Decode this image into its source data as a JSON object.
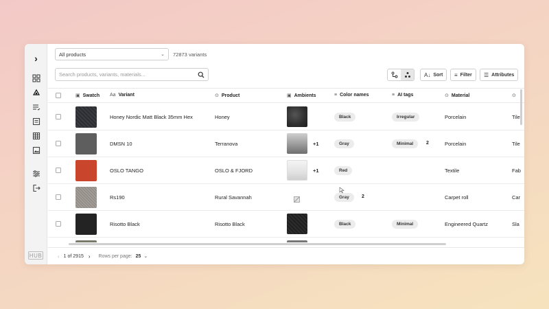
{
  "sidebar": {
    "expand_icon": "chevron-right-icon",
    "logo_text": "HUB",
    "items": [
      {
        "name": "dashboard-icon"
      },
      {
        "name": "products-icon"
      },
      {
        "name": "list-icon"
      },
      {
        "name": "catalog-icon"
      },
      {
        "name": "grid-icon"
      },
      {
        "name": "image-icon"
      },
      {
        "name": "settings-sliders-icon"
      },
      {
        "name": "logout-icon"
      }
    ]
  },
  "topbar": {
    "product_select": "All products",
    "variants_count": "72873 variants"
  },
  "search": {
    "placeholder": "Search products, variants, materials..."
  },
  "toolbar": {
    "sort_label": "Sort",
    "filter_label": "Filter",
    "attributes_label": "Attributes"
  },
  "table": {
    "columns": {
      "swatch": "Swatch",
      "variant": "Variant",
      "product": "Product",
      "ambients": "Ambients",
      "color_names": "Color names",
      "ai_tags": "AI tags",
      "material": "Material"
    },
    "rows": [
      {
        "variant": "Honey Nordic Matt Black 35mm Hex",
        "product": "Honey",
        "ambient_extra": "",
        "color": "Black",
        "color_extra": "",
        "ai_tag": "Irregular",
        "ai_extra": "",
        "material": "Porcelain",
        "next_col": "Tile",
        "swatch_color": "#2b2d31"
      },
      {
        "variant": "DMSN 10",
        "product": "Terranova",
        "ambient_extra": "+1",
        "color": "Gray",
        "color_extra": "",
        "ai_tag": "Minimal",
        "ai_extra": "2",
        "material": "Porcelain",
        "next_col": "Tile",
        "swatch_color": "#5e5e5e"
      },
      {
        "variant": "OSLO TANGO",
        "product": "OSLO & FJORD",
        "ambient_extra": "+1",
        "color": "Red",
        "color_extra": "",
        "ai_tag": "",
        "ai_extra": "",
        "material": "Textile",
        "next_col": "Fab",
        "swatch_color": "#c9452c"
      },
      {
        "variant": "Rs190",
        "product": "Rural Savannah",
        "ambient_extra": "",
        "color": "Gray",
        "color_extra": "2",
        "ai_tag": "",
        "ai_extra": "",
        "material": "Carpet roll",
        "next_col": "Car",
        "swatch_color": "#8d8783"
      },
      {
        "variant": "Risotto Black",
        "product": "Risotto Black",
        "ambient_extra": "",
        "color": "Black",
        "color_extra": "",
        "ai_tag": "Minimal",
        "ai_extra": "",
        "material": "Engineered Quartz",
        "next_col": "Sla",
        "swatch_color": "#232323"
      }
    ]
  },
  "footer": {
    "page_info": "1 of 2915",
    "rows_per_page_label": "Rows per page:",
    "rows_per_page_value": "25"
  }
}
